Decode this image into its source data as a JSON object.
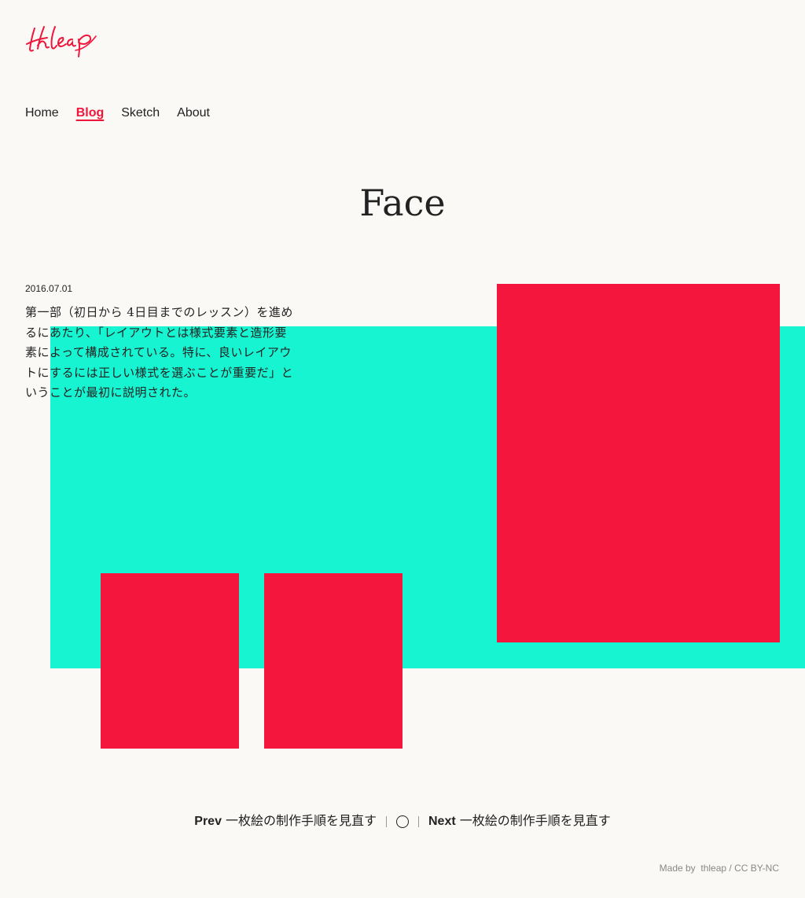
{
  "brand": {
    "logo_text": "thleap",
    "accent_color": "#ef163c",
    "mint_color": "#17f4d1"
  },
  "nav": {
    "items": [
      {
        "label": "Home"
      },
      {
        "label": "Blog",
        "active": true
      },
      {
        "label": "Sketch"
      },
      {
        "label": "About"
      }
    ]
  },
  "post": {
    "title": "Face",
    "date": "2016.07.01",
    "lines": [
      "第一部（初日から 4日目までのレッスン）を進め",
      "るにあたり、「レイアウトとは様式要素と造形要",
      "素によって構成されている。特に、良いレイアウ",
      "トにするには正しい様式を選ぶことが重要だ」と",
      "いうことが最初に説明された。"
    ]
  },
  "pager": {
    "prev_label": "Prev",
    "prev_title": "一枚絵の制作手順を見直す",
    "next_label": "Next",
    "next_title": "一枚絵の制作手順を見直す",
    "home_icon": "circle-icon"
  },
  "footer": {
    "made_by": "Made by",
    "author": "thleap",
    "sep": "/",
    "license": "CC BY-NC"
  }
}
